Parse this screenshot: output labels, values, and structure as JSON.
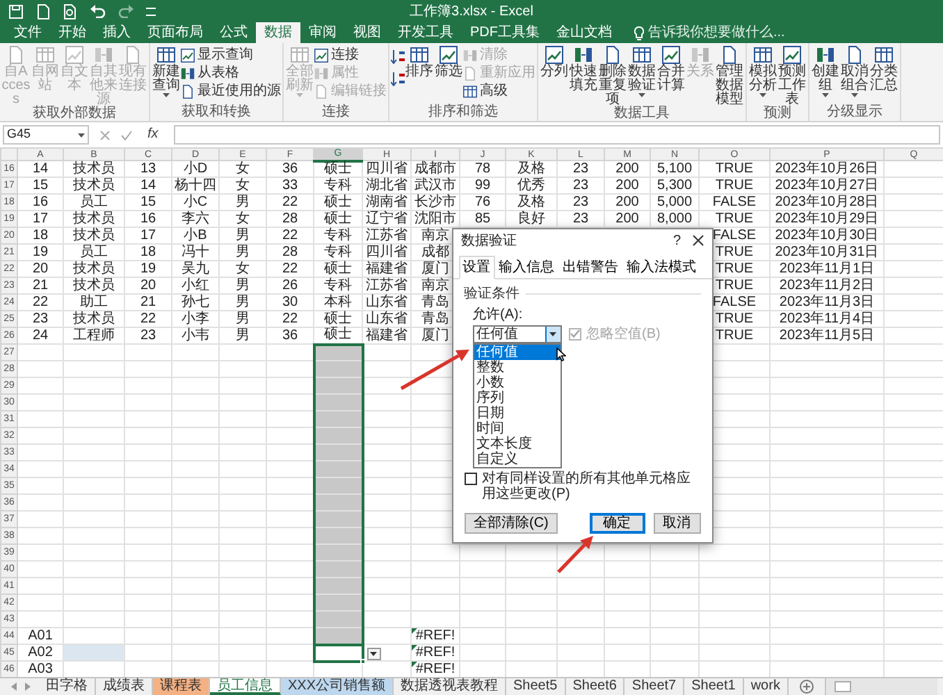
{
  "window": {
    "title": "工作簿3.xlsx - Excel"
  },
  "ribbon_tabs": [
    {
      "label": "文件",
      "selected": false
    },
    {
      "label": "开始",
      "selected": false
    },
    {
      "label": "插入",
      "selected": false
    },
    {
      "label": "页面布局",
      "selected": false
    },
    {
      "label": "公式",
      "selected": false
    },
    {
      "label": "数据",
      "selected": true
    },
    {
      "label": "审阅",
      "selected": false
    },
    {
      "label": "视图",
      "selected": false
    },
    {
      "label": "开发工具",
      "selected": false
    },
    {
      "label": "PDF工具集",
      "selected": false
    },
    {
      "label": "金山文档",
      "selected": false
    }
  ],
  "tell_me": {
    "placeholder": "告诉我你想要做什么..."
  },
  "ribbon_groups": [
    {
      "label": "获取外部数据",
      "items": [
        {
          "kind": "big",
          "label": "自Access",
          "disabled": true,
          "dropdown": false
        },
        {
          "kind": "big",
          "label": "自网站",
          "disabled": true,
          "dropdown": false
        },
        {
          "kind": "big",
          "label": "自文本",
          "disabled": true,
          "dropdown": false
        },
        {
          "kind": "big",
          "label": "自其他来源",
          "disabled": true,
          "dropdown": false
        },
        {
          "kind": "big",
          "label": "现有连接",
          "disabled": true,
          "dropdown": false
        }
      ]
    },
    {
      "label": "获取和转换",
      "items": [
        {
          "kind": "big",
          "label": "新建查询",
          "disabled": false,
          "dropdown": true
        },
        {
          "kind": "stack",
          "items": [
            {
              "label": "显示查询",
              "disabled": false
            },
            {
              "label": "从表格",
              "disabled": false
            },
            {
              "label": "最近使用的源",
              "disabled": false
            }
          ]
        }
      ]
    },
    {
      "label": "连接",
      "items": [
        {
          "kind": "big",
          "label": "全部刷新",
          "disabled": true,
          "dropdown": true
        },
        {
          "kind": "stack",
          "items": [
            {
              "label": "连接",
              "disabled": false
            },
            {
              "label": "属性",
              "disabled": true
            },
            {
              "label": "编辑链接",
              "disabled": true
            }
          ]
        }
      ]
    },
    {
      "label": "排序和筛选",
      "items": [
        {
          "kind": "sort_icons"
        },
        {
          "kind": "big",
          "label": "排序",
          "disabled": false,
          "dropdown": false
        },
        {
          "kind": "big",
          "label": "筛选",
          "disabled": false,
          "dropdown": false
        },
        {
          "kind": "stack",
          "items": [
            {
              "label": "清除",
              "disabled": true
            },
            {
              "label": "重新应用",
              "disabled": true
            },
            {
              "label": "高级",
              "disabled": false
            }
          ]
        }
      ]
    },
    {
      "label": "数据工具",
      "items": [
        {
          "kind": "big",
          "label": "分列",
          "disabled": false,
          "dropdown": false
        },
        {
          "kind": "big",
          "label": "快速填充",
          "disabled": false,
          "dropdown": false
        },
        {
          "kind": "big",
          "label": "删除重复项",
          "disabled": false,
          "dropdown": false
        },
        {
          "kind": "big",
          "label": "数据验证",
          "disabled": false,
          "dropdown": true
        },
        {
          "kind": "big",
          "label": "合并计算",
          "disabled": false,
          "dropdown": false
        },
        {
          "kind": "big",
          "label": "关系",
          "disabled": true,
          "dropdown": false
        },
        {
          "kind": "big",
          "label": "管理数据模型",
          "disabled": false,
          "dropdown": false
        }
      ]
    },
    {
      "label": "预测",
      "items": [
        {
          "kind": "big",
          "label": "模拟分析",
          "disabled": false,
          "dropdown": true
        },
        {
          "kind": "big",
          "label": "预测工作表",
          "disabled": false,
          "dropdown": false
        }
      ]
    },
    {
      "label": "分级显示",
      "items": [
        {
          "kind": "big",
          "label": "创建组",
          "disabled": false,
          "dropdown": true
        },
        {
          "kind": "big",
          "label": "取消组合",
          "disabled": false,
          "dropdown": true
        },
        {
          "kind": "big",
          "label": "分类汇总",
          "disabled": false,
          "dropdown": false
        }
      ]
    }
  ],
  "formula_bar": {
    "name_box": "G45",
    "function_label": "fx"
  },
  "columns": [
    {
      "label": "A",
      "selected": false
    },
    {
      "label": "B",
      "selected": false
    },
    {
      "label": "C",
      "selected": false
    },
    {
      "label": "D",
      "selected": false
    },
    {
      "label": "E",
      "selected": false
    },
    {
      "label": "F",
      "selected": false
    },
    {
      "label": "G",
      "selected": true
    },
    {
      "label": "H",
      "selected": false
    },
    {
      "label": "I",
      "selected": false
    },
    {
      "label": "J",
      "selected": false
    },
    {
      "label": "K",
      "selected": false
    },
    {
      "label": "L",
      "selected": false
    },
    {
      "label": "M",
      "selected": false
    },
    {
      "label": "N",
      "selected": false
    },
    {
      "label": "O",
      "selected": false
    },
    {
      "label": "P",
      "selected": false
    },
    {
      "label": "Q",
      "selected": false
    }
  ],
  "rows": [
    {
      "header": "16",
      "in_selection": false,
      "active": false,
      "cells": {
        "A": "14",
        "B": "技术员",
        "C": "13",
        "D": "小D",
        "E": "女",
        "F": "36",
        "G": "硕士",
        "H": "四川省",
        "I": "成都市",
        "J": "78",
        "K": "及格",
        "L": "23",
        "M": "200",
        "N": "5,100",
        "O": "TRUE",
        "P": "2023年10月26日"
      }
    },
    {
      "header": "17",
      "in_selection": false,
      "active": false,
      "cells": {
        "A": "15",
        "B": "技术员",
        "C": "14",
        "D": "杨十四",
        "E": "女",
        "F": "33",
        "G": "专科",
        "H": "湖北省",
        "I": "武汉市",
        "J": "99",
        "K": "优秀",
        "L": "23",
        "M": "200",
        "N": "5,300",
        "O": "TRUE",
        "P": "2023年10月27日"
      }
    },
    {
      "header": "18",
      "in_selection": false,
      "active": false,
      "cells": {
        "A": "16",
        "B": "员工",
        "C": "15",
        "D": "小C",
        "E": "男",
        "F": "22",
        "G": "硕士",
        "H": "湖南省",
        "I": "长沙市",
        "J": "76",
        "K": "及格",
        "L": "23",
        "M": "200",
        "N": "5,000",
        "O": "FALSE",
        "P": "2023年10月28日"
      }
    },
    {
      "header": "19",
      "in_selection": false,
      "active": false,
      "cells": {
        "A": "17",
        "B": "技术员",
        "C": "16",
        "D": "李六",
        "E": "女",
        "F": "28",
        "G": "硕士",
        "H": "辽宁省",
        "I": "沈阳市",
        "J": "85",
        "K": "良好",
        "L": "23",
        "M": "200",
        "N": "8,000",
        "O": "TRUE",
        "P": "2023年10月29日"
      }
    },
    {
      "header": "20",
      "in_selection": false,
      "active": false,
      "cells": {
        "A": "18",
        "B": "技术员",
        "C": "17",
        "D": "小B",
        "E": "男",
        "F": "22",
        "G": "专科",
        "H": "江苏省",
        "I": "南京",
        "O": "FALSE",
        "P": "2023年10月30日"
      }
    },
    {
      "header": "21",
      "in_selection": false,
      "active": false,
      "cells": {
        "A": "19",
        "B": "员工",
        "C": "18",
        "D": "冯十",
        "E": "男",
        "F": "28",
        "G": "专科",
        "H": "四川省",
        "I": "成都",
        "O": "TRUE",
        "P": "2023年10月31日"
      }
    },
    {
      "header": "22",
      "in_selection": false,
      "active": false,
      "cells": {
        "A": "20",
        "B": "技术员",
        "C": "19",
        "D": "吴九",
        "E": "女",
        "F": "22",
        "G": "硕士",
        "H": "福建省",
        "I": "厦门",
        "O": "TRUE",
        "P": "2023年11月1日"
      }
    },
    {
      "header": "23",
      "in_selection": false,
      "active": false,
      "cells": {
        "A": "21",
        "B": "技术员",
        "C": "20",
        "D": "小红",
        "E": "男",
        "F": "26",
        "G": "专科",
        "H": "江苏省",
        "I": "南京",
        "O": "TRUE",
        "P": "2023年11月2日"
      }
    },
    {
      "header": "24",
      "in_selection": false,
      "active": false,
      "cells": {
        "A": "22",
        "B": "助工",
        "C": "21",
        "D": "孙七",
        "E": "男",
        "F": "30",
        "G": "本科",
        "H": "山东省",
        "I": "青岛",
        "O": "FALSE",
        "P": "2023年11月3日"
      }
    },
    {
      "header": "25",
      "in_selection": false,
      "active": false,
      "cells": {
        "A": "23",
        "B": "技术员",
        "C": "22",
        "D": "小李",
        "E": "男",
        "F": "22",
        "G": "硕士",
        "H": "山东省",
        "I": "青岛",
        "O": "TRUE",
        "P": "2023年11月4日"
      }
    },
    {
      "header": "26",
      "in_selection": false,
      "active": false,
      "cells": {
        "A": "24",
        "B": "工程师",
        "C": "23",
        "D": "小韦",
        "E": "男",
        "F": "36",
        "G": "硕士",
        "H": "福建省",
        "I": "厦门",
        "O": "TRUE",
        "P": "2023年11月5日"
      }
    },
    {
      "header": "27",
      "in_selection": true,
      "active": false
    },
    {
      "header": "28",
      "in_selection": true,
      "active": false
    },
    {
      "header": "29",
      "in_selection": true,
      "active": false
    },
    {
      "header": "30",
      "in_selection": true,
      "active": false
    },
    {
      "header": "31",
      "in_selection": true,
      "active": false
    },
    {
      "header": "32",
      "in_selection": true,
      "active": false
    },
    {
      "header": "33",
      "in_selection": true,
      "active": false
    },
    {
      "header": "34",
      "in_selection": true,
      "active": false
    },
    {
      "header": "35",
      "in_selection": true,
      "active": false
    },
    {
      "header": "36",
      "in_selection": true,
      "active": false
    },
    {
      "header": "37",
      "in_selection": true,
      "active": false
    },
    {
      "header": "38",
      "in_selection": true,
      "active": false
    },
    {
      "header": "39",
      "in_selection": true,
      "active": false
    },
    {
      "header": "40",
      "in_selection": true,
      "active": false
    },
    {
      "header": "41",
      "in_selection": true,
      "active": false
    },
    {
      "header": "42",
      "in_selection": true,
      "active": false
    },
    {
      "header": "43",
      "in_selection": true,
      "active": false
    },
    {
      "header": "44",
      "in_selection": true,
      "active": false,
      "cells": {
        "A": "A01",
        "I": {
          "text": "#REF!",
          "flagged": true
        }
      }
    },
    {
      "header": "45",
      "in_selection": true,
      "active": true,
      "cells": {
        "A": "A02",
        "B": {
          "highlighted": true
        },
        "I": {
          "text": "#REF!",
          "flagged": true
        }
      }
    },
    {
      "header": "46",
      "in_selection": false,
      "active": false,
      "cells": {
        "A": "A03",
        "I": {
          "text": "#REF!",
          "flagged": true
        }
      }
    }
  ],
  "dialog": {
    "title": "数据验证",
    "help": "?",
    "tabs": [
      {
        "label": "设置",
        "selected": true
      },
      {
        "label": "输入信息",
        "selected": false
      },
      {
        "label": "出错警告",
        "selected": false
      },
      {
        "label": "输入法模式",
        "selected": false
      }
    ],
    "section": "验证条件",
    "allow_label": "允许(A):",
    "allow_value": "任何值",
    "dropdown_open": true,
    "options": [
      {
        "label": "任何值",
        "selected": true
      },
      {
        "label": "整数",
        "selected": false
      },
      {
        "label": "小数",
        "selected": false
      },
      {
        "label": "序列",
        "selected": false
      },
      {
        "label": "日期",
        "selected": false
      },
      {
        "label": "时间",
        "selected": false
      },
      {
        "label": "文本长度",
        "selected": false
      },
      {
        "label": "自定义",
        "selected": false
      }
    ],
    "ignore_blank": {
      "label": "忽略空值(B)",
      "checked": true,
      "disabled": true
    },
    "apply_all": {
      "label": "对有同样设置的所有其他单元格应用这些更改(P)",
      "checked": false
    },
    "buttons": [
      {
        "label": "全部清除(C)",
        "kind": "normal"
      },
      {
        "label": "确定",
        "kind": "default"
      },
      {
        "label": "取消",
        "kind": "normal"
      }
    ]
  },
  "sheet_tabs": [
    {
      "label": "田字格",
      "selected": false
    },
    {
      "label": "成绩表",
      "selected": false
    },
    {
      "label": "课程表",
      "selected": false,
      "color": "#f4b183"
    },
    {
      "label": "员工信息",
      "selected": true
    },
    {
      "label": "XXX公司销售额",
      "selected": false,
      "color": "#bdd7ee"
    },
    {
      "label": "数据透视表教程",
      "selected": false
    },
    {
      "label": "Sheet5",
      "selected": false
    },
    {
      "label": "Sheet6",
      "selected": false
    },
    {
      "label": "Sheet7",
      "selected": false
    },
    {
      "label": "Sheet1",
      "selected": false
    },
    {
      "label": "work",
      "selected": false
    }
  ]
}
